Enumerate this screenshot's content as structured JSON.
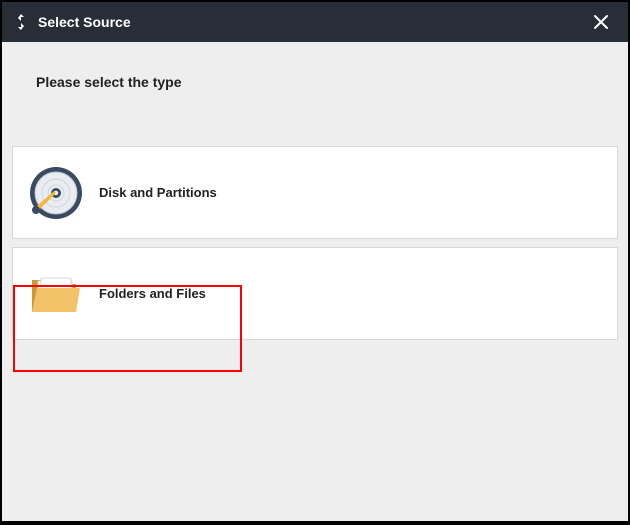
{
  "titlebar": {
    "title": "Select Source"
  },
  "prompt": "Please select the type",
  "options": [
    {
      "label": "Disk and Partitions",
      "icon": "disk"
    },
    {
      "label": "Folders and Files",
      "icon": "folder"
    }
  ]
}
